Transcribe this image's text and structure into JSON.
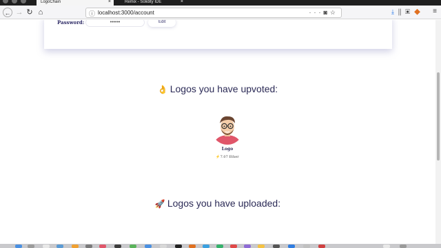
{
  "browser": {
    "tabs": [
      {
        "title": "LogoChain",
        "active": true
      },
      {
        "title": "Remix - Solidity IDE",
        "active": false
      }
    ],
    "url": "localhost:3000/account"
  },
  "account": {
    "password_label": "Password:",
    "password_value": "••••••",
    "edit_label": "Edit"
  },
  "upvoted": {
    "emoji": "👌",
    "title": "Logos you have upvoted:",
    "items": [
      {
        "name": "Logo",
        "price": "7.07 Ether"
      }
    ]
  },
  "uploaded": {
    "emoji": "🚀",
    "title": "Logos you have uploaded:"
  },
  "icons": {
    "back": "arrow-left-icon",
    "forward": "arrow-right-icon",
    "reload": "reload-icon",
    "home": "home-icon",
    "info": "info-icon",
    "download": "download-icon",
    "library": "library-icon",
    "sidebar": "sidebar-icon",
    "extension": "extension-icon",
    "price": "lightning-icon"
  },
  "colors": {
    "heading": "#2b2a56",
    "download": "#1e73e8",
    "price_bolt": "#f5b800"
  }
}
